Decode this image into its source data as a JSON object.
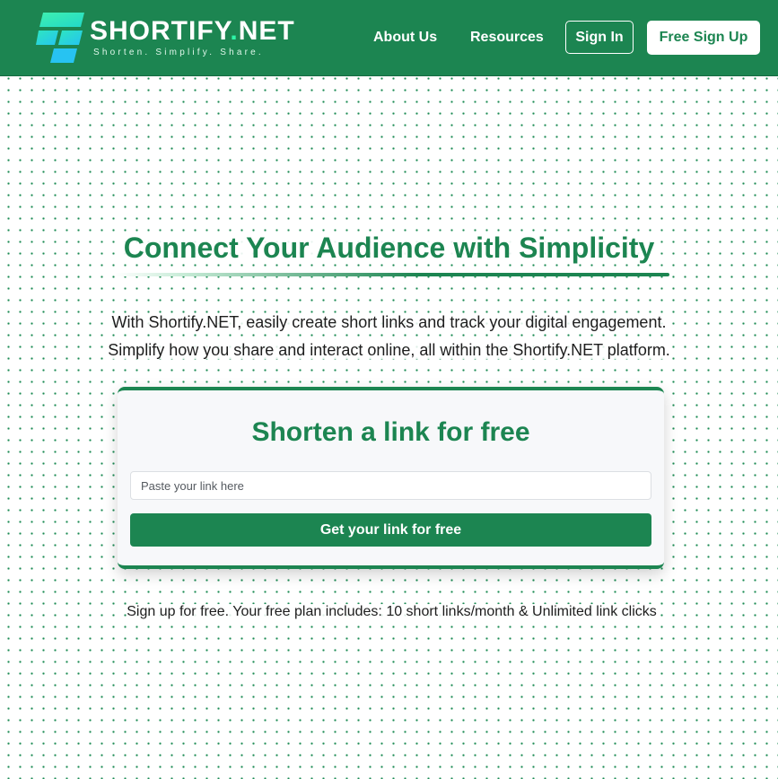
{
  "brand": {
    "name_main": "SHORTIFY",
    "name_dot": ".",
    "name_suffix": "NET",
    "tagline": "Shorten. Simplify. Share.",
    "logo_icon": "stacked-tiles-logo-icon"
  },
  "nav": {
    "about": "About Us",
    "resources": "Resources",
    "sign_in": "Sign In",
    "sign_up": "Free Sign Up"
  },
  "hero": {
    "title": "Connect Your Audience with Simplicity",
    "desc_line1": "With Shortify.NET, easily create short links and track your digital engagement.",
    "desc_line2": "Simplify how you share and interact online, all within the Shortify.NET platform."
  },
  "shortener": {
    "title": "Shorten a link for free",
    "input_placeholder": "Paste your link here",
    "input_value": "",
    "button_label": "Get your link for free"
  },
  "plan_note": "Sign up for free. Your free plan includes: 10 short links/month & Unlimited link clicks",
  "colors": {
    "brand_green": "#1c8551",
    "logo_cyan": "#2ef5a8",
    "logo_blue": "#29c6f0"
  }
}
